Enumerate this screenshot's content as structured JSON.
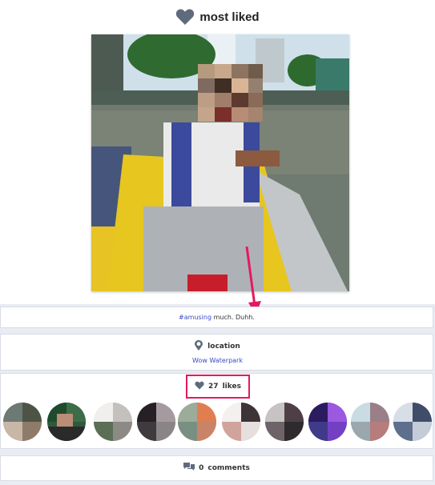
{
  "header": {
    "title": "most liked",
    "icon": "heart-icon"
  },
  "photo": {
    "description_icon": "boat-photo"
  },
  "caption": {
    "hashtag": "#amusing",
    "text": " much. Duhh."
  },
  "location": {
    "label": "location",
    "value": "Wow Waterpark",
    "icon": "map-pin-icon"
  },
  "likes": {
    "count": "27",
    "label": "likes",
    "icon": "heart-icon"
  },
  "comments": {
    "count": "0",
    "label": "comments",
    "icon": "chat-icon"
  },
  "colors": {
    "accent": "#e4195f",
    "link": "#3a49c9",
    "icon": "#5f6b7d"
  }
}
